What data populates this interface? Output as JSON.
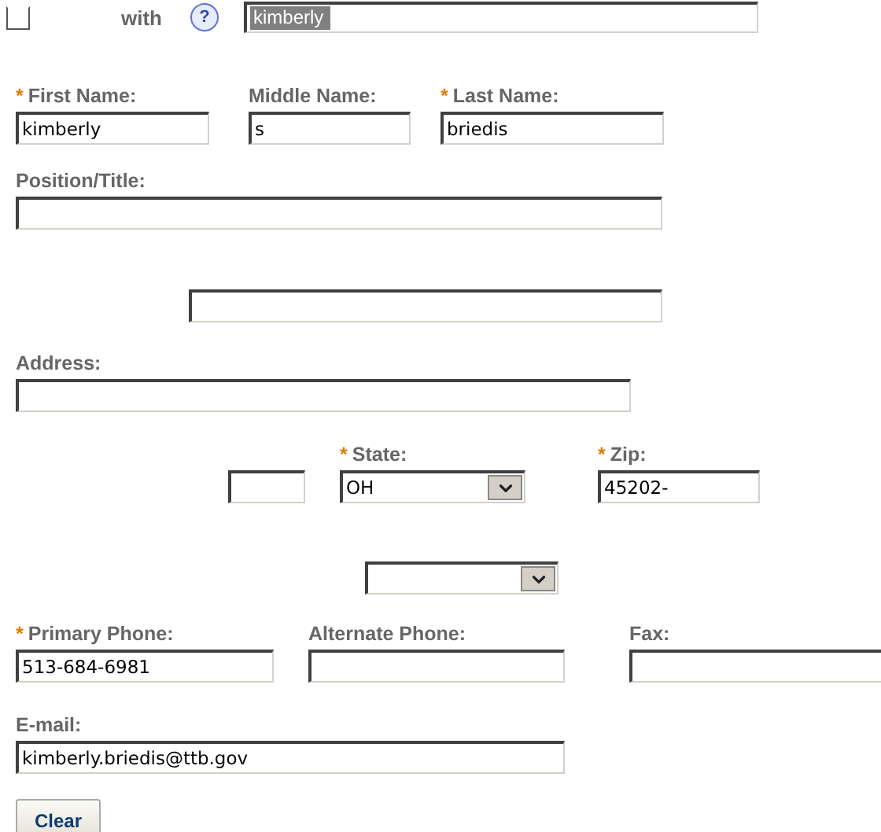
{
  "auto_fill": {
    "checked": false,
    "label": "with",
    "help_symbol": "?",
    "value": "kimberly"
  },
  "rows": [
    {
      "fields": [
        {
          "kind": "text",
          "label": "First Name:",
          "required": true,
          "value": "kimberly"
        },
        {
          "kind": "text",
          "label": "Middle Name:",
          "required": false,
          "value": "s"
        },
        {
          "kind": "text",
          "label": "Last Name:",
          "required": true,
          "value": "briedis"
        }
      ]
    },
    {
      "fields": [
        {
          "kind": "text",
          "label": "Position/Title:",
          "required": false
        }
      ]
    },
    {
      "fields": [
        {
          "kind": "text"
        }
      ]
    },
    {
      "fields": [
        {
          "kind": "text",
          "label": "Address:",
          "required": false
        }
      ]
    },
    {
      "fields": [
        {
          "kind": "text"
        },
        {
          "kind": "select",
          "label": "State:",
          "required": true,
          "value": "OH"
        },
        {
          "kind": "text",
          "label": "Zip:",
          "required": true,
          "value": "45202-"
        }
      ]
    },
    {
      "fields": [
        {
          "kind": "select"
        }
      ]
    },
    {
      "fields": [
        {
          "kind": "text",
          "label": "Primary Phone:",
          "required": true,
          "value": "513-684-6981"
        },
        {
          "kind": "text",
          "label": "Alternate Phone:",
          "required": false
        },
        {
          "kind": "text",
          "label": "Fax:",
          "required": false
        }
      ]
    },
    {
      "fields": [
        {
          "kind": "text",
          "label": "E-mail:",
          "required": false,
          "value": "kimberly.briedis@ttb.gov"
        }
      ]
    }
  ],
  "required_mark": "*",
  "clear_button": "Clear"
}
